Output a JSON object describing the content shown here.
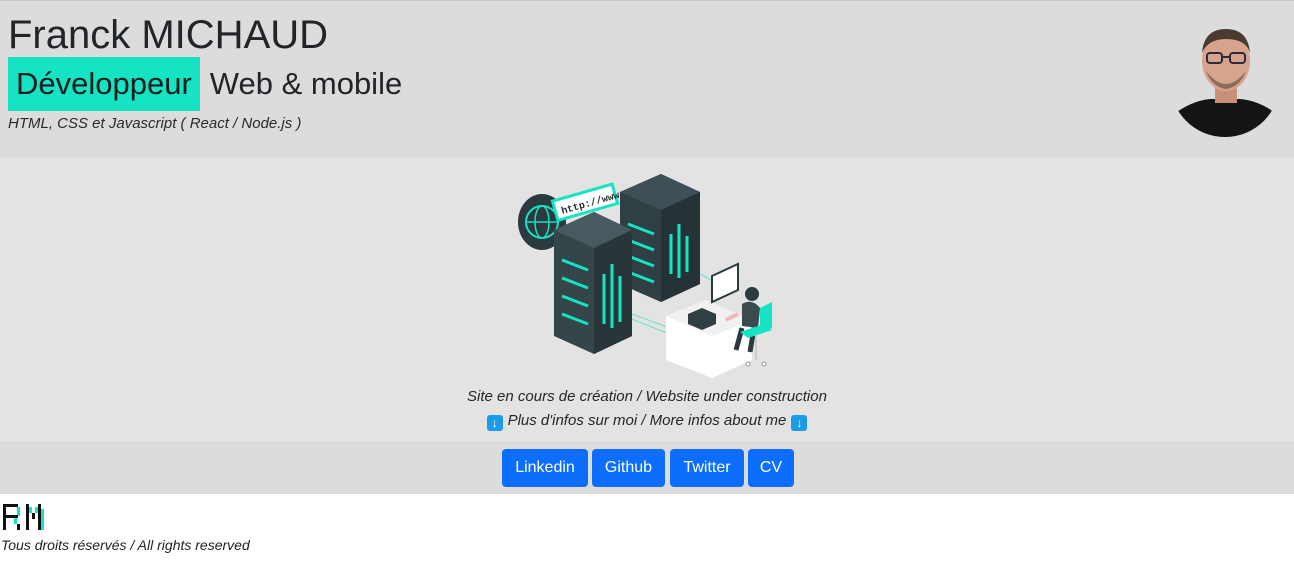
{
  "header": {
    "name": "Franck MICHAUD",
    "role_highlight": "Développeur",
    "role_rest": "Web & mobile",
    "stack": "HTML, CSS et Javascript ( React / Node.js )"
  },
  "main": {
    "illustration_text": "http://www.",
    "caption": "Site en cours de création / Website under construction",
    "more_info": "Plus d'infos sur moi / More infos about me"
  },
  "links": {
    "linkedin": "Linkedin",
    "github": "Github",
    "twitter": "Twitter",
    "cv": "CV"
  },
  "footer": {
    "rights": "Tous droits réservés / All rights reserved"
  },
  "colors": {
    "accent": "#16e3c3",
    "button": "#0d6efd",
    "header_bg": "#dcdcdc",
    "main_bg": "#e3e3e3",
    "info_icon": "#1c9be6"
  },
  "icons": {
    "more_info_left": "down-arrow-icon",
    "more_info_right": "down-arrow-icon"
  }
}
